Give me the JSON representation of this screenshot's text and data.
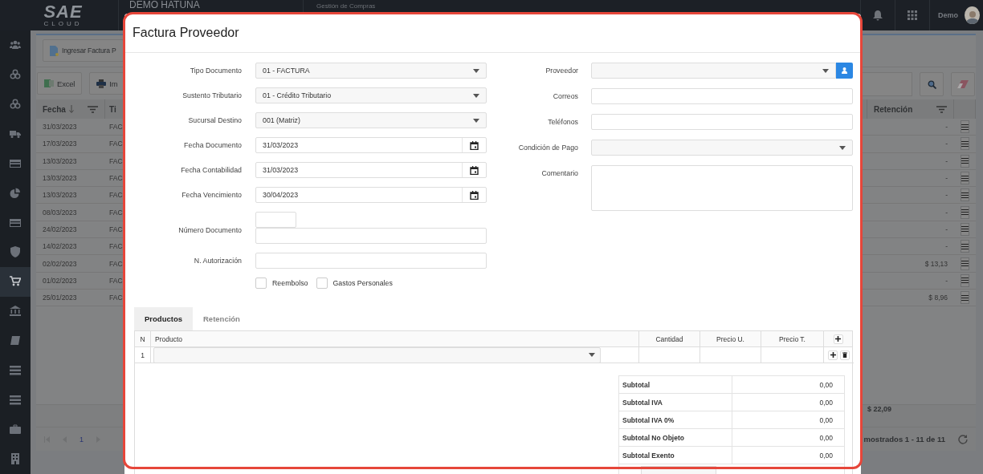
{
  "topbar": {
    "logo": {
      "name": "SAE",
      "tagline": "CLOUD"
    },
    "company": "DEMO HATUNA",
    "module": "Gestión de Compras",
    "user": "Demo"
  },
  "sidebar": {
    "items": [
      {
        "selected": false
      },
      {
        "selected": false
      },
      {
        "selected": false
      },
      {
        "selected": false
      },
      {
        "selected": false
      },
      {
        "selected": false
      },
      {
        "selected": false
      },
      {
        "selected": false
      },
      {
        "selected": true
      },
      {
        "selected": false
      },
      {
        "selected": false
      },
      {
        "selected": false
      },
      {
        "selected": false
      },
      {
        "selected": false
      },
      {
        "selected": false
      }
    ]
  },
  "background": {
    "action_button": "Ingresar Factura P",
    "toolbar": [
      "Excel",
      "Im"
    ],
    "table": {
      "columns": [
        "Fecha",
        "Ti",
        "Retención"
      ],
      "rows": [
        {
          "fecha": "31/03/2023",
          "tipo": "FAC",
          "retencion": "-"
        },
        {
          "fecha": "17/03/2023",
          "tipo": "FAC",
          "retencion": "-"
        },
        {
          "fecha": "13/03/2023",
          "tipo": "FAC",
          "retencion": "-"
        },
        {
          "fecha": "13/03/2023",
          "tipo": "FAC",
          "retencion": "-"
        },
        {
          "fecha": "13/03/2023",
          "tipo": "FAC",
          "retencion": "-"
        },
        {
          "fecha": "08/03/2023",
          "tipo": "FAC",
          "retencion": "-"
        },
        {
          "fecha": "24/02/2023",
          "tipo": "FAC",
          "retencion": "-"
        },
        {
          "fecha": "14/02/2023",
          "tipo": "FAC",
          "retencion": "-"
        },
        {
          "fecha": "02/02/2023",
          "tipo": "FAC",
          "retencion": "$ 13,13"
        },
        {
          "fecha": "01/02/2023",
          "tipo": "FAC",
          "retencion": "-"
        },
        {
          "fecha": "25/01/2023",
          "tipo": "FAC",
          "retencion": "$ 8,96"
        }
      ],
      "total": "$ 22,09"
    },
    "pager": {
      "page": "1",
      "summary": "mostrados 1 - 11 de 11"
    }
  },
  "modal": {
    "title": "Factura Proveedor",
    "left_fields": [
      {
        "kind": "select",
        "label": "Tipo Documento",
        "value": "01 - FACTURA"
      },
      {
        "kind": "select",
        "label": "Sustento Tributario",
        "value": "01 - Crédito Tributario"
      },
      {
        "kind": "select",
        "label": "Sucursal Destino",
        "value": "001 (Matriz)"
      },
      {
        "kind": "date",
        "label": "Fecha Documento",
        "value": "31/03/2023"
      },
      {
        "kind": "date",
        "label": "Fecha Contabilidad",
        "value": "31/03/2023"
      },
      {
        "kind": "date",
        "label": "Fecha Vencimiento",
        "value": "30/04/2023"
      },
      {
        "kind": "number",
        "label": "Número Documento"
      },
      {
        "kind": "text",
        "label": "N. Autorización"
      }
    ],
    "checkboxes": [
      {
        "label": "Reembolso",
        "checked": false
      },
      {
        "label": "Gastos Personales",
        "checked": false
      }
    ],
    "right_fields": [
      {
        "kind": "lookup",
        "label": "Proveedor"
      },
      {
        "kind": "text",
        "label": "Correos"
      },
      {
        "kind": "text",
        "label": "Teléfonos"
      },
      {
        "kind": "select",
        "label": "Condición de Pago"
      },
      {
        "kind": "textarea",
        "label": "Comentario"
      }
    ],
    "tabs": [
      {
        "label": "Productos",
        "selected": true
      },
      {
        "label": "Retención",
        "selected": false
      }
    ],
    "lines": {
      "columns": [
        "N",
        "Producto",
        "Cantidad",
        "Precio U.",
        "Precio T."
      ],
      "rows": [
        {
          "n": "1"
        }
      ]
    },
    "totals": [
      {
        "label": "Subtotal",
        "value": "0,00"
      },
      {
        "label": "Subtotal IVA",
        "value": "0,00"
      },
      {
        "label": "Subtotal IVA 0%",
        "value": "0,00"
      },
      {
        "label": "Subtotal No Objeto",
        "value": "0,00"
      },
      {
        "label": "Subtotal Exento",
        "value": "0,00"
      }
    ]
  }
}
